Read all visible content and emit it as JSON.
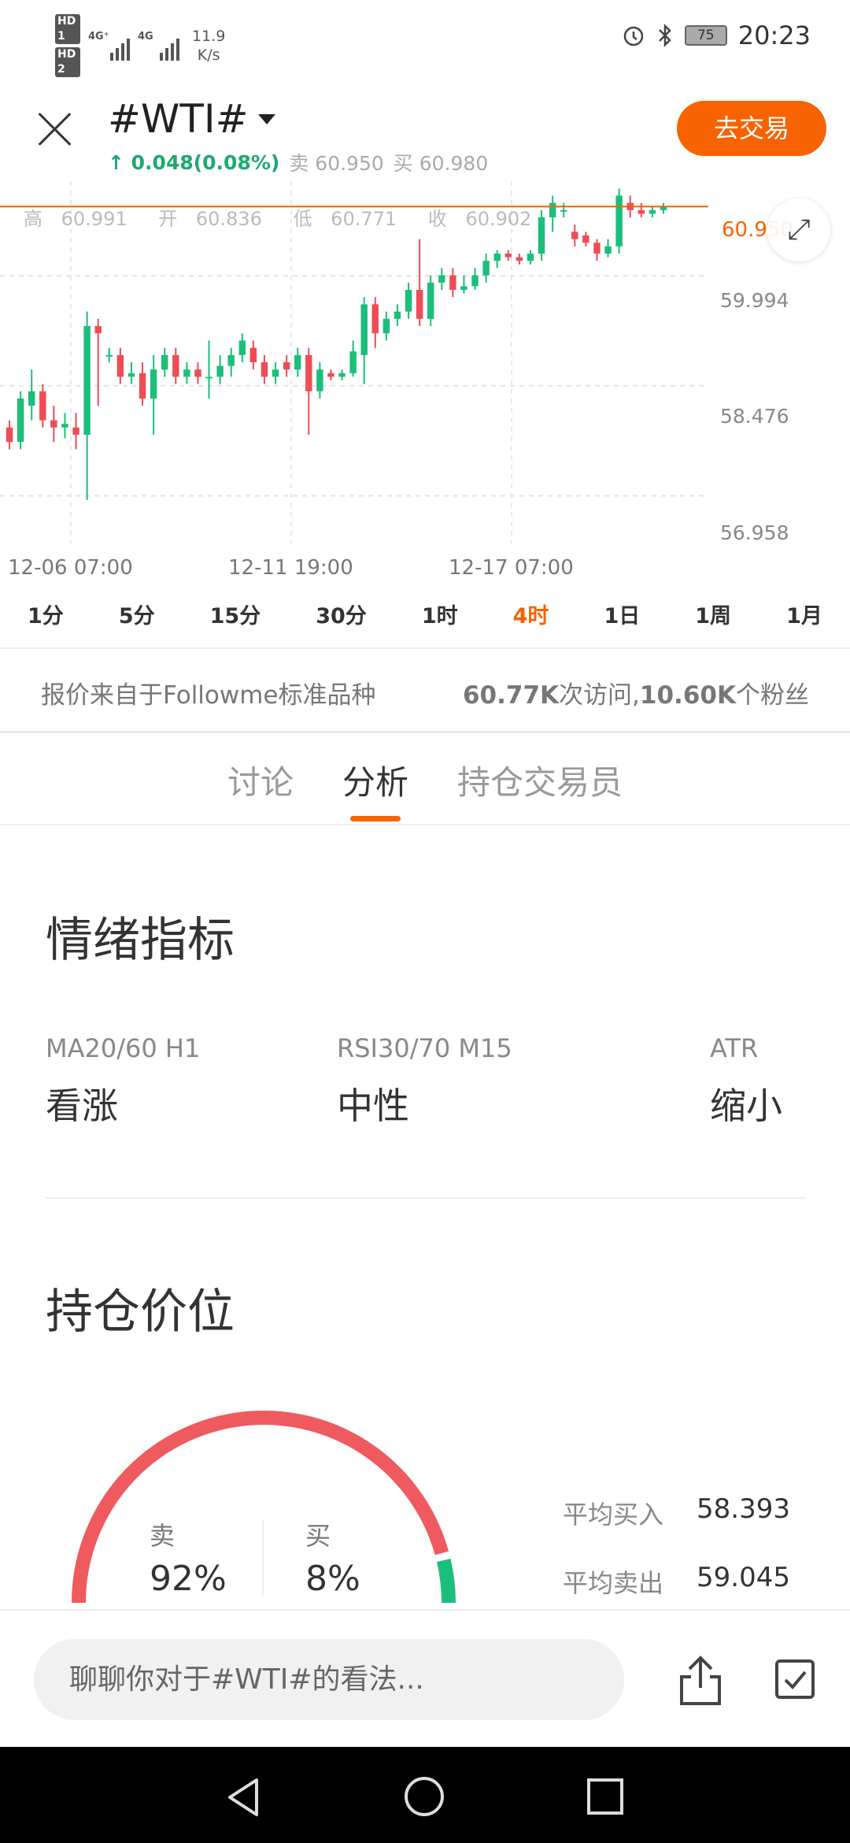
{
  "status_bar": {
    "hd1": "HD 1",
    "hd2": "HD 2",
    "net1": "4G⁺",
    "net2": "4G",
    "speed_value": "11.9",
    "speed_unit": "K/s",
    "battery": "75",
    "time": "20:23",
    "icons": [
      "alarm-icon",
      "bluetooth-icon",
      "battery-icon",
      "signal-icon"
    ]
  },
  "header": {
    "symbol": "#WTI#",
    "change": "0.048(0.08%)",
    "sell_label": "卖",
    "sell_price": "60.950",
    "buy_label": "买",
    "buy_price": "60.980",
    "trade_button": "去交易"
  },
  "chart": {
    "ohlc": {
      "high_label": "高",
      "high": "60.991",
      "open_label": "开",
      "open": "60.836",
      "low_label": "低",
      "low": "60.771",
      "close_label": "收",
      "close": "60.902"
    },
    "current_price": "60.950",
    "y_labels": [
      "59.994",
      "58.476",
      "56.958"
    ],
    "x_labels": [
      "12-06 07:00",
      "12-11 19:00",
      "12-17 07:00"
    ],
    "colors": {
      "up": "#1bbf7a",
      "down": "#ee4d56",
      "accent": "#f76300"
    }
  },
  "chart_data": {
    "type": "candlestick",
    "title": "",
    "xlabel": "",
    "ylabel": "",
    "ylim": [
      56.3,
      61.3
    ],
    "x_ticks": [
      "12-06 07:00",
      "12-11 19:00",
      "12-17 07:00"
    ],
    "y_ticks": [
      59.994,
      58.476,
      56.958
    ],
    "current_line": 60.95,
    "candles": [
      {
        "o": 57.9,
        "c": 57.7,
        "h": 58.0,
        "l": 57.6
      },
      {
        "o": 57.7,
        "c": 58.3,
        "h": 58.4,
        "l": 57.6
      },
      {
        "o": 58.2,
        "c": 58.4,
        "h": 58.7,
        "l": 58.0
      },
      {
        "o": 58.4,
        "c": 58.0,
        "h": 58.5,
        "l": 57.9
      },
      {
        "o": 58.0,
        "c": 57.9,
        "h": 58.2,
        "l": 57.7
      },
      {
        "o": 57.9,
        "c": 57.95,
        "h": 58.1,
        "l": 57.75
      },
      {
        "o": 57.9,
        "c": 57.8,
        "h": 58.1,
        "l": 57.6
      },
      {
        "o": 57.8,
        "c": 59.3,
        "h": 59.5,
        "l": 56.9
      },
      {
        "o": 59.3,
        "c": 59.2,
        "h": 59.4,
        "l": 58.2
      },
      {
        "o": 58.9,
        "c": 58.9,
        "h": 59.0,
        "l": 58.8
      },
      {
        "o": 58.9,
        "c": 58.6,
        "h": 59.0,
        "l": 58.5
      },
      {
        "o": 58.6,
        "c": 58.65,
        "h": 58.8,
        "l": 58.5
      },
      {
        "o": 58.65,
        "c": 58.3,
        "h": 58.8,
        "l": 58.2
      },
      {
        "o": 58.3,
        "c": 58.7,
        "h": 58.9,
        "l": 57.8
      },
      {
        "o": 58.7,
        "c": 58.9,
        "h": 59.0,
        "l": 58.6
      },
      {
        "o": 58.9,
        "c": 58.6,
        "h": 59.0,
        "l": 58.5
      },
      {
        "o": 58.6,
        "c": 58.7,
        "h": 58.8,
        "l": 58.5
      },
      {
        "o": 58.7,
        "c": 58.6,
        "h": 58.8,
        "l": 58.5
      },
      {
        "o": 58.6,
        "c": 58.6,
        "h": 59.1,
        "l": 58.3
      },
      {
        "o": 58.6,
        "c": 58.75,
        "h": 58.9,
        "l": 58.5
      },
      {
        "o": 58.75,
        "c": 58.9,
        "h": 59.0,
        "l": 58.6
      },
      {
        "o": 58.9,
        "c": 59.1,
        "h": 59.2,
        "l": 58.8
      },
      {
        "o": 59.0,
        "c": 58.8,
        "h": 59.1,
        "l": 58.7
      },
      {
        "o": 58.8,
        "c": 58.6,
        "h": 58.9,
        "l": 58.5
      },
      {
        "o": 58.6,
        "c": 58.7,
        "h": 58.8,
        "l": 58.5
      },
      {
        "o": 58.8,
        "c": 58.7,
        "h": 58.9,
        "l": 58.6
      },
      {
        "o": 58.7,
        "c": 58.9,
        "h": 59.0,
        "l": 58.6
      },
      {
        "o": 58.9,
        "c": 58.4,
        "h": 59.0,
        "l": 57.8
      },
      {
        "o": 58.4,
        "c": 58.7,
        "h": 58.8,
        "l": 58.3
      },
      {
        "o": 58.65,
        "c": 58.6,
        "h": 58.7,
        "l": 58.55
      },
      {
        "o": 58.6,
        "c": 58.65,
        "h": 58.7,
        "l": 58.55
      },
      {
        "o": 58.65,
        "c": 58.95,
        "h": 59.1,
        "l": 58.6
      },
      {
        "o": 58.9,
        "c": 59.6,
        "h": 59.7,
        "l": 58.5
      },
      {
        "o": 59.6,
        "c": 59.2,
        "h": 59.7,
        "l": 59.0
      },
      {
        "o": 59.2,
        "c": 59.4,
        "h": 59.5,
        "l": 59.1
      },
      {
        "o": 59.4,
        "c": 59.5,
        "h": 59.6,
        "l": 59.3
      },
      {
        "o": 59.5,
        "c": 59.8,
        "h": 59.9,
        "l": 59.4
      },
      {
        "o": 59.8,
        "c": 59.4,
        "h": 60.5,
        "l": 59.3
      },
      {
        "o": 59.4,
        "c": 59.9,
        "h": 60.0,
        "l": 59.3
      },
      {
        "o": 59.9,
        "c": 60.0,
        "h": 60.1,
        "l": 59.8
      },
      {
        "o": 60.0,
        "c": 59.8,
        "h": 60.1,
        "l": 59.7
      },
      {
        "o": 59.8,
        "c": 59.85,
        "h": 60.0,
        "l": 59.75
      },
      {
        "o": 59.85,
        "c": 60.0,
        "h": 60.1,
        "l": 59.8
      },
      {
        "o": 60.0,
        "c": 60.2,
        "h": 60.3,
        "l": 59.9
      },
      {
        "o": 60.2,
        "c": 60.3,
        "h": 60.35,
        "l": 60.1
      },
      {
        "o": 60.3,
        "c": 60.25,
        "h": 60.35,
        "l": 60.2
      },
      {
        "o": 60.25,
        "c": 60.2,
        "h": 60.3,
        "l": 60.15
      },
      {
        "o": 60.2,
        "c": 60.3,
        "h": 60.35,
        "l": 60.15
      },
      {
        "o": 60.3,
        "c": 60.8,
        "h": 60.9,
        "l": 60.2
      },
      {
        "o": 60.8,
        "c": 61.0,
        "h": 61.1,
        "l": 60.6
      },
      {
        "o": 60.9,
        "c": 60.9,
        "h": 61.0,
        "l": 60.8
      },
      {
        "o": 60.6,
        "c": 60.5,
        "h": 60.7,
        "l": 60.4
      },
      {
        "o": 60.55,
        "c": 60.45,
        "h": 60.6,
        "l": 60.4
      },
      {
        "o": 60.45,
        "c": 60.3,
        "h": 60.5,
        "l": 60.2
      },
      {
        "o": 60.3,
        "c": 60.4,
        "h": 60.5,
        "l": 60.25
      },
      {
        "o": 60.4,
        "c": 61.1,
        "h": 61.2,
        "l": 60.3
      },
      {
        "o": 61.0,
        "c": 60.9,
        "h": 61.1,
        "l": 60.8
      },
      {
        "o": 60.9,
        "c": 60.85,
        "h": 61.0,
        "l": 60.8
      },
      {
        "o": 60.85,
        "c": 60.9,
        "h": 60.95,
        "l": 60.8
      },
      {
        "o": 60.9,
        "c": 60.95,
        "h": 61.0,
        "l": 60.85
      }
    ]
  },
  "periods": [
    {
      "label": "1分"
    },
    {
      "label": "5分"
    },
    {
      "label": "15分"
    },
    {
      "label": "30分"
    },
    {
      "label": "1时"
    },
    {
      "label": "4时",
      "active": true
    },
    {
      "label": "1日"
    },
    {
      "label": "1周"
    },
    {
      "label": "1月"
    }
  ],
  "info": {
    "source": "报价来自于Followme标准品种",
    "visits_value": "60.77K",
    "visits_text": "次访问,",
    "fans_value": "10.60K",
    "fans_text": "个粉丝"
  },
  "tabs": [
    {
      "label": "讨论"
    },
    {
      "label": "分析",
      "active": true
    },
    {
      "label": "持仓交易员"
    }
  ],
  "sentiment": {
    "title": "情绪指标",
    "indicators": [
      {
        "name": "MA20/60 H1",
        "value": "看涨"
      },
      {
        "name": "RSI30/70 M15",
        "value": "中性"
      },
      {
        "name": "ATR",
        "value": "缩小"
      }
    ]
  },
  "positions": {
    "title": "持仓价位",
    "sell_label": "卖",
    "sell_pct": "92%",
    "buy_label": "买",
    "buy_pct": "8%",
    "sell_fraction": 0.92,
    "avg_buy_label": "平均买入",
    "avg_buy": "58.393",
    "avg_sell_label": "平均卖出",
    "avg_sell": "59.045"
  },
  "bottom": {
    "comment_placeholder": "聊聊你对于#WTI#的看法..."
  }
}
